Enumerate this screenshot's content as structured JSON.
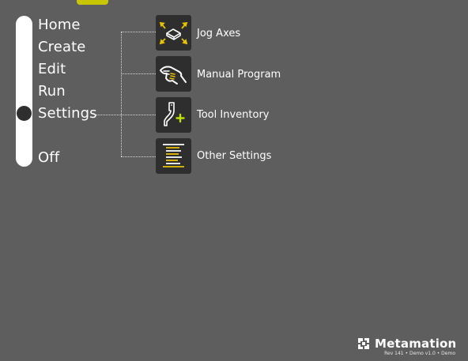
{
  "menu": {
    "items": [
      {
        "label": "Home"
      },
      {
        "label": "Create"
      },
      {
        "label": "Edit"
      },
      {
        "label": "Run"
      },
      {
        "label": "Settings"
      },
      {
        "label": "Off"
      }
    ],
    "selected": "Settings"
  },
  "submenu": {
    "items": [
      {
        "label": "Jog Axes",
        "icon": "jog-axes-icon"
      },
      {
        "label": "Manual Program",
        "icon": "wrench-hand-icon"
      },
      {
        "label": "Tool Inventory",
        "icon": "tool-add-icon"
      },
      {
        "label": "Other Settings",
        "icon": "settings-list-icon"
      }
    ]
  },
  "brand": {
    "name": "Metamation",
    "version": "Rev 141 • Demo v1.0 • Demo"
  },
  "colors": {
    "background": "#5e5e5e",
    "accent": "#c8c400",
    "tile": "#2e2e2e",
    "plus": "#bfe000"
  }
}
